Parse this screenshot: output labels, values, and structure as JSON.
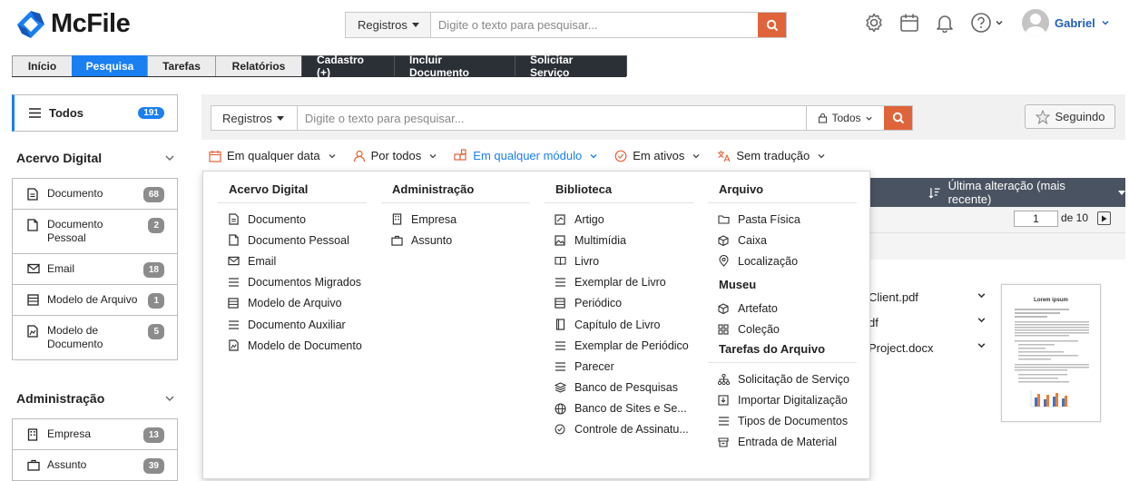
{
  "app": {
    "name": "McFile"
  },
  "header": {
    "search": {
      "scope": "Registros",
      "placeholder": "Digite o texto para pesquisar..."
    },
    "user": {
      "name": "Gabriel"
    }
  },
  "nav": {
    "tabs": [
      "Início",
      "Pesquisa",
      "Tarefas",
      "Relatórios",
      "Cadastro (+)",
      "Incluir Documento",
      "Solicitar Serviço"
    ]
  },
  "sidebar": {
    "todos": {
      "label": "Todos",
      "count": "191"
    },
    "sections": [
      {
        "title": "Acervo Digital",
        "items": [
          {
            "label": "Documento",
            "count": "68",
            "icon": "document-icon"
          },
          {
            "label": "Documento Pessoal",
            "count": "2",
            "icon": "file-icon"
          },
          {
            "label": "Email",
            "count": "18",
            "icon": "mail-icon"
          },
          {
            "label": "Modelo de Arquivo",
            "count": "1",
            "icon": "list-box-icon"
          },
          {
            "label": "Modelo de Documento",
            "count": "5",
            "icon": "template-icon"
          }
        ]
      },
      {
        "title": "Administração",
        "items": [
          {
            "label": "Empresa",
            "count": "13",
            "icon": "building-icon"
          },
          {
            "label": "Assunto",
            "count": "39",
            "icon": "briefcase-icon"
          }
        ]
      }
    ]
  },
  "main": {
    "search": {
      "scope": "Registros",
      "placeholder": "Digite o texto para pesquisar...",
      "filter": "Todos"
    },
    "follow_label": "Seguindo",
    "filters": [
      "Em qualquer data",
      "Por todos",
      "Em qualquer módulo",
      "Em ativos",
      "Sem tradução"
    ],
    "sort_label": "Última alteração (mais recente)",
    "pagination": {
      "current": "1",
      "of_label": "de 10"
    },
    "files": [
      "Client.pdf",
      "df",
      "Project.docx"
    ],
    "thumbnail_title": "Lorem ipsum"
  },
  "dropdown": {
    "columns": [
      {
        "title": "Acervo Digital",
        "items": [
          "Documento",
          "Documento Pessoal",
          "Email",
          "Documentos Migrados",
          "Modelo de Arquivo",
          "Documento Auxiliar",
          "Modelo de Documento"
        ]
      },
      {
        "title": "Administração",
        "items": [
          "Empresa",
          "Assunto"
        ]
      },
      {
        "title": "Biblioteca",
        "items": [
          "Artigo",
          "Multimídia",
          "Livro",
          "Exemplar de Livro",
          "Periódico",
          "Capítulo de Livro",
          "Exemplar de Periódico",
          "Parecer",
          "Banco de Pesquisas",
          "Banco de Sites e Se...",
          "Controle de Assinatu..."
        ]
      },
      {
        "title": "Arquivo",
        "items": [
          "Pasta Física",
          "Caixa",
          "Localização"
        ],
        "museu_title": "Museu",
        "museu_items": [
          "Artefato",
          "Coleção"
        ],
        "tarefas_title": "Tarefas do Arquivo",
        "tarefas_items": [
          "Solicitação de Serviço",
          "Importar Digitalização",
          "Tipos de Documentos",
          "Entrada de Material"
        ]
      }
    ]
  },
  "colors": {
    "accent": "#1a7ff0",
    "search_button": "#e0643a",
    "dark_tab": "#2b2f36",
    "sort_bar": "#4a5361"
  }
}
